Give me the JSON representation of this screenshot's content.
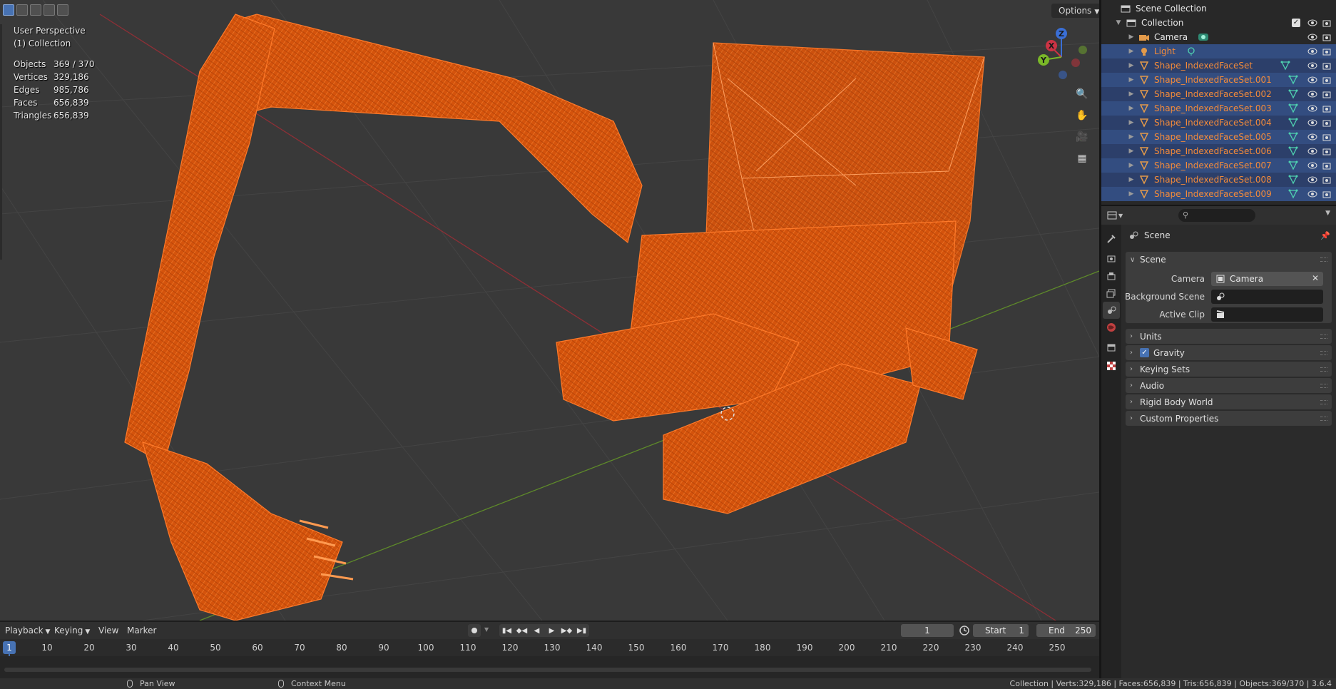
{
  "viewport": {
    "perspective": "User Perspective",
    "collection": "(1) Collection",
    "options_label": "Options",
    "stats": [
      {
        "label": "Objects",
        "value": "369 / 370"
      },
      {
        "label": "Vertices",
        "value": "329,186"
      },
      {
        "label": "Edges",
        "value": "985,786"
      },
      {
        "label": "Faces",
        "value": "656,839"
      },
      {
        "label": "Triangles",
        "value": "656,839"
      }
    ],
    "gizmo": {
      "x": "X",
      "y": "Y",
      "z": "Z"
    },
    "colors": {
      "background": "#393939",
      "selection": "#e8590c",
      "x_axis": "#b0333c",
      "y_axis": "#6b9a2f"
    }
  },
  "outliner": {
    "root": "Scene Collection",
    "collection": "Collection",
    "items": [
      {
        "name": "Camera",
        "icon": "camera-icon",
        "color": "white"
      },
      {
        "name": "Light",
        "icon": "light-icon",
        "color": "orange"
      },
      {
        "name": "Shape_IndexedFaceSet",
        "icon": "mesh-icon",
        "color": "orange"
      },
      {
        "name": "Shape_IndexedFaceSet.001",
        "icon": "mesh-icon",
        "color": "orange"
      },
      {
        "name": "Shape_IndexedFaceSet.002",
        "icon": "mesh-icon",
        "color": "orange"
      },
      {
        "name": "Shape_IndexedFaceSet.003",
        "icon": "mesh-icon",
        "color": "orange"
      },
      {
        "name": "Shape_IndexedFaceSet.004",
        "icon": "mesh-icon",
        "color": "orange"
      },
      {
        "name": "Shape_IndexedFaceSet.005",
        "icon": "mesh-icon",
        "color": "orange"
      },
      {
        "name": "Shape_IndexedFaceSet.006",
        "icon": "mesh-icon",
        "color": "orange"
      },
      {
        "name": "Shape_IndexedFaceSet.007",
        "icon": "mesh-icon",
        "color": "orange"
      },
      {
        "name": "Shape_IndexedFaceSet.008",
        "icon": "mesh-icon",
        "color": "orange"
      },
      {
        "name": "Shape_IndexedFaceSet.009",
        "icon": "mesh-icon",
        "color": "orange"
      }
    ]
  },
  "properties": {
    "title": "Scene",
    "panel_scene": "Scene",
    "fields": {
      "camera_label": "Camera",
      "camera_value": "Camera",
      "background_label": "Background Scene",
      "clip_label": "Active Clip"
    },
    "panels": [
      "Units",
      "Gravity",
      "Keying Sets",
      "Audio",
      "Rigid Body World",
      "Custom Properties"
    ]
  },
  "timeline": {
    "menus": [
      "Playback",
      "Keying",
      "View",
      "Marker"
    ],
    "current_frame": "1",
    "start_label": "Start",
    "start_value": "1",
    "end_label": "End",
    "end_value": "250",
    "ruler": [
      "10",
      "20",
      "30",
      "40",
      "50",
      "60",
      "70",
      "80",
      "90",
      "100",
      "110",
      "120",
      "130",
      "140",
      "150",
      "160",
      "170",
      "180",
      "190",
      "200",
      "210",
      "220",
      "230",
      "240",
      "250"
    ]
  },
  "statusbar": {
    "pan": "Pan View",
    "context": "Context Menu",
    "info": "Collection | Verts:329,186 | Faces:656,839 | Tris:656,839 | Objects:369/370 | 3.6.4"
  }
}
